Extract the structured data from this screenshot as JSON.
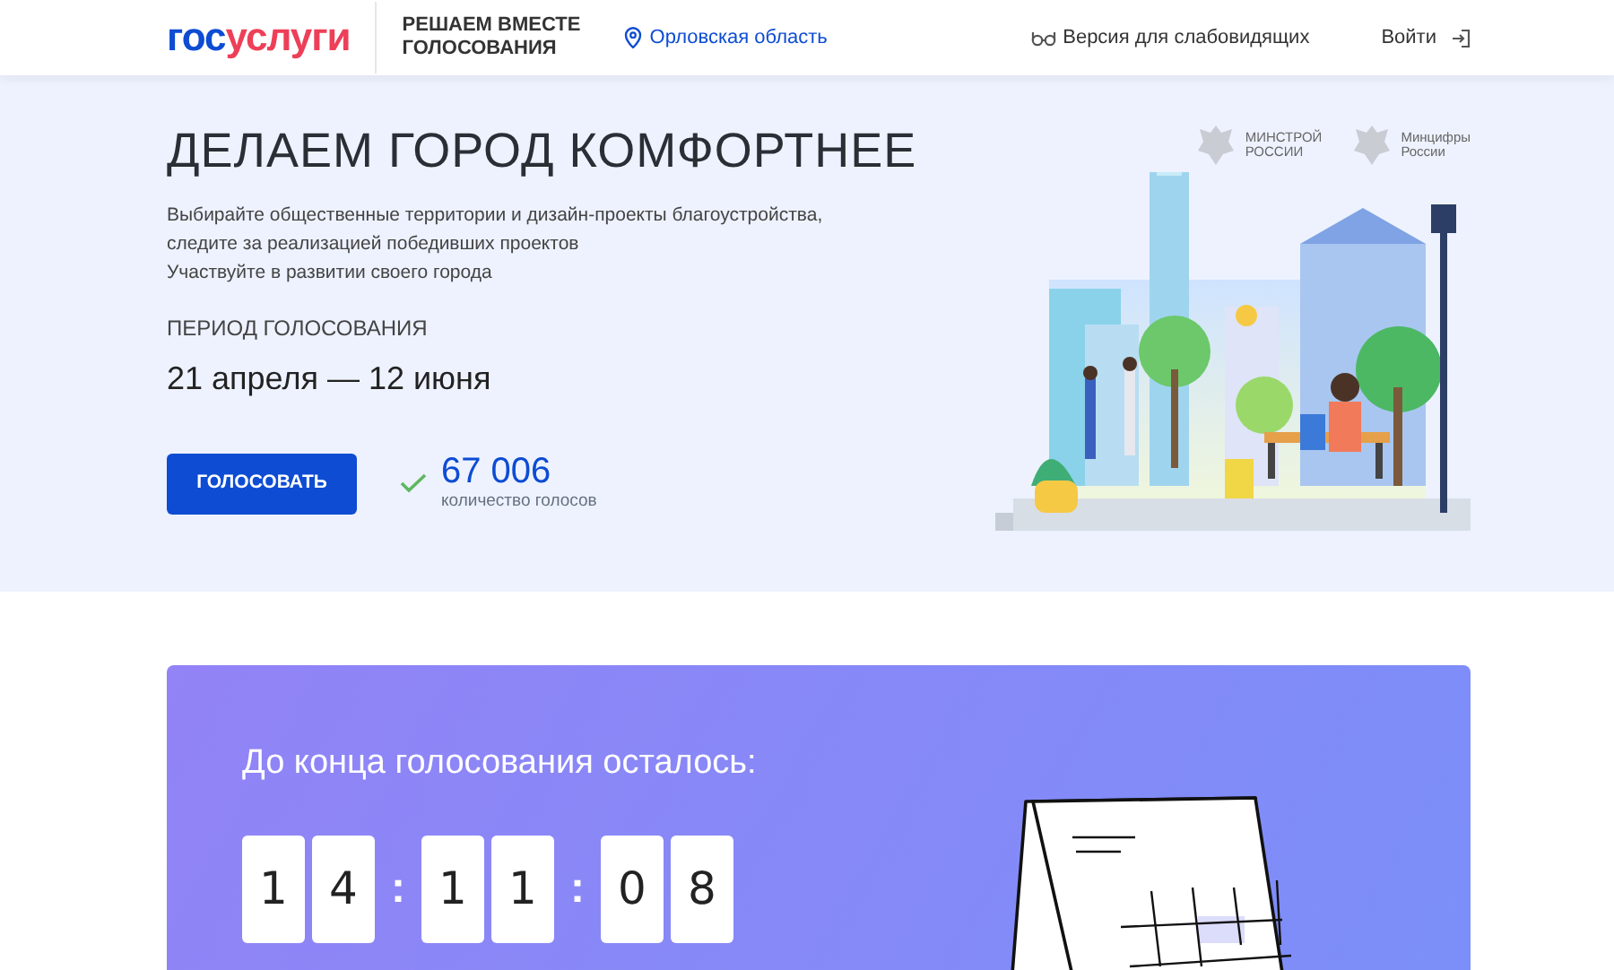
{
  "header": {
    "logo": {
      "primary": "гос",
      "accent": "услуги"
    },
    "project_title": "РЕШАЕМ ВМЕСТЕ ГОЛОСОВАНИЯ",
    "region": "Орловская область",
    "accessibility": "Версия для слабовидящих",
    "login": "Войти"
  },
  "hero": {
    "title": "ДЕЛАЕМ ГОРОД КОМФОРТНЕЕ",
    "description": [
      "Выбирайте общественные территории и дизайн-проекты благоустройства,",
      "следите за реализацией победивших проектов",
      "Участвуйте в развитии своего города"
    ],
    "period_label": "ПЕРИОД ГОЛОСОВАНИЯ",
    "period": "21 апреля — 12 июня",
    "vote_button": "ГОЛОСОВАТЬ",
    "votes_count": "67 006",
    "votes_label": "количество голосов",
    "partners": [
      {
        "line1": "МИНСТРОЙ",
        "line2": "РОССИИ"
      },
      {
        "line1": "Минцифры",
        "line2": "России"
      }
    ]
  },
  "countdown": {
    "title": "До конца голосования осталось:",
    "separator": ":",
    "groups": [
      {
        "digits": [
          "1",
          "4"
        ]
      },
      {
        "digits": [
          "1",
          "1"
        ]
      },
      {
        "digits": [
          "0",
          "8"
        ]
      }
    ]
  }
}
